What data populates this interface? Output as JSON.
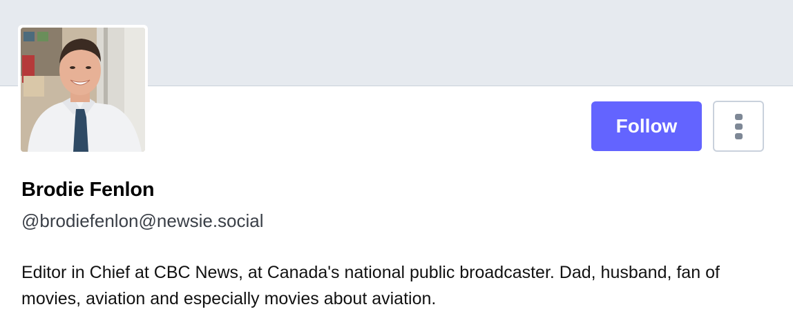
{
  "profile": {
    "display_name": "Brodie Fenlon",
    "handle": "@brodiefenlon@newsie.social",
    "bio": "Editor in Chief at CBC News, at Canada's national public broadcaster. Dad, husband, fan of movies, aviation and especially movies about aviation."
  },
  "actions": {
    "follow_label": "Follow",
    "more_icon": "kebab-menu-icon"
  },
  "colors": {
    "banner": "#e6eaef",
    "follow_button": "#6364ff",
    "text": "#000000"
  }
}
